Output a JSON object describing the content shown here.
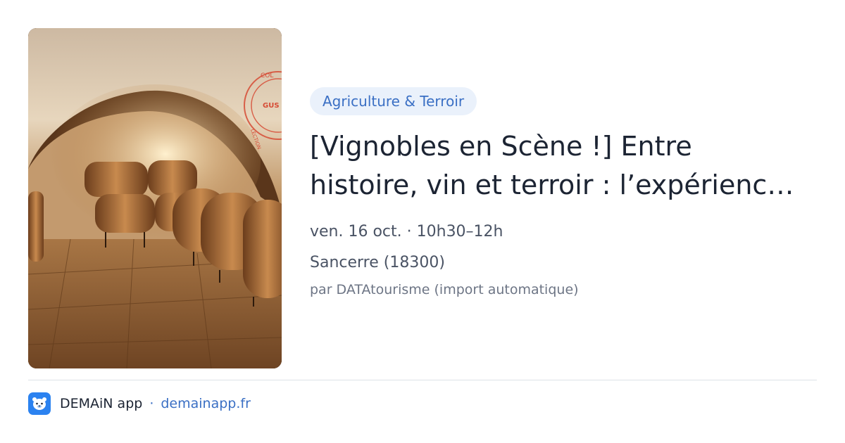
{
  "event": {
    "category": "Agriculture & Terroir",
    "title_line_1": "[Vignobles en Scène !] Entre",
    "title_line_2": "histoire, vin et terroir : l’expérienc…",
    "date": "ven. 16 oct. · 10h30–12h",
    "location": "Sancerre (18300)",
    "source": "par DATAtourisme (import automatique)",
    "image": {
      "subject": "wine-cellar-photo",
      "stamp_text_1": "COL",
      "stamp_text_2": "GUS",
      "stamp_text_3": "LECTION"
    }
  },
  "footer": {
    "app_name": "DEMAiN app",
    "separator": "·",
    "url": "demainapp.fr",
    "logo_icon": "demain-bear-icon"
  },
  "colors": {
    "accent": "#3a6fc4",
    "tag_background": "#eaf1fb",
    "logo_background": "#2b82f0"
  }
}
